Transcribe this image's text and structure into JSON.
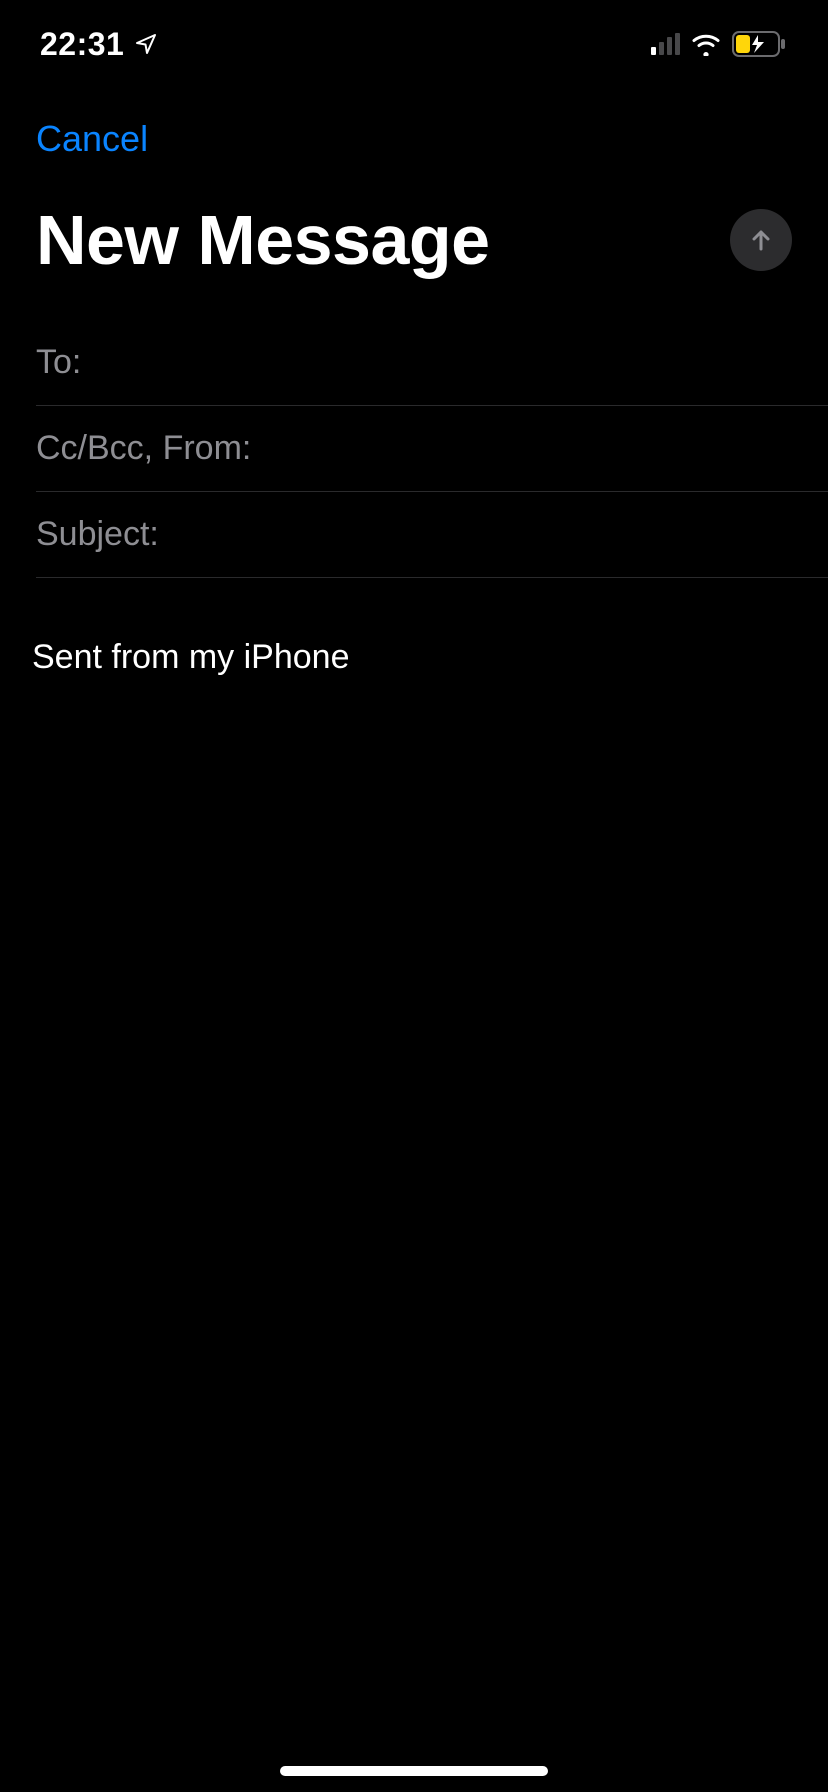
{
  "status": {
    "time": "22:31"
  },
  "nav": {
    "cancel_label": "Cancel"
  },
  "header": {
    "title": "New Message"
  },
  "fields": {
    "to_label": "To:",
    "to_value": "",
    "cc_label": "Cc/Bcc, From:",
    "cc_value": "",
    "subject_label": "Subject:",
    "subject_value": ""
  },
  "body": {
    "signature": "Sent from my iPhone"
  }
}
